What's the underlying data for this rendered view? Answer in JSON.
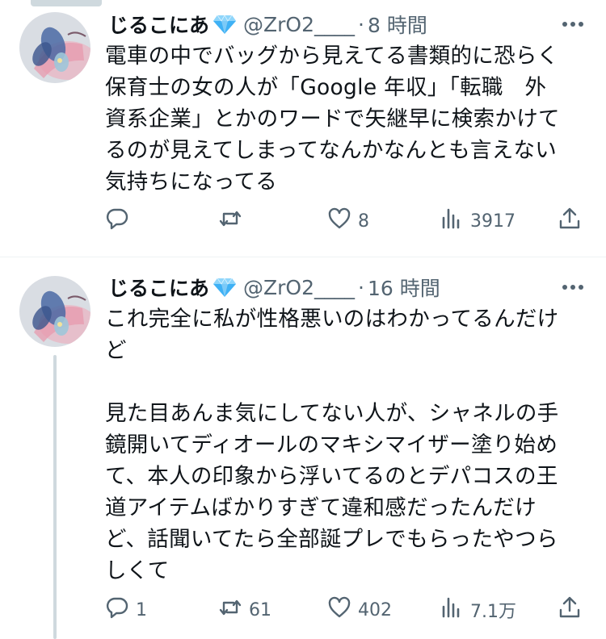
{
  "tweets": [
    {
      "display_name": "じるこにあ",
      "handle": "@ZrO2____",
      "separator": "·",
      "time": "8 時間",
      "text": "電車の中でバッグから見えてる書類的に恐らく\n保育士の女の人が「Google 年収」「転職　外\n資系企業」とかのワードで矢継早に検索かけて\nるのが見えてしまってなんかなんとも言えない\n気持ちになってる",
      "actions": {
        "reply": "",
        "retweet": "",
        "like": "8",
        "views": "3917"
      }
    },
    {
      "display_name": "じるこにあ",
      "handle": "@ZrO2____",
      "separator": "·",
      "time": "16 時間",
      "text": "これ完全に私が性格悪いのはわかってるんだけ\nど\n\n見た目あんま気にしてない人が、シャネルの手\n鏡開いてディオールのマキシマイザー塗り始め\nて、本人の印象から浮いてるのとデパコスの王\n道アイテムばかりすぎて違和感だったんだけ\nど、話聞いてたら全部誕プレでもらったやつら\nしくて",
      "actions": {
        "reply": "1",
        "retweet": "61",
        "like": "402",
        "views": "7.1万"
      }
    }
  ],
  "icons": [
    "verified-badge-icon",
    "more-icon",
    "reply-icon",
    "retweet-icon",
    "like-icon",
    "views-icon",
    "share-icon"
  ],
  "colors": {
    "text": "#0f1419",
    "secondary": "#536471",
    "badge": "#3fb1f5",
    "thread_line": "#cfd9de"
  }
}
